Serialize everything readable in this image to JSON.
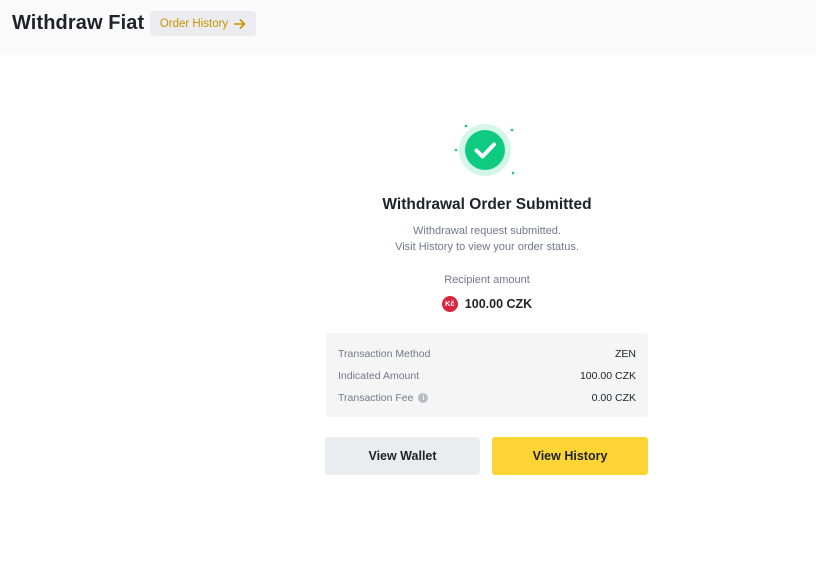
{
  "header": {
    "title": "Withdraw Fiat",
    "order_history_label": "Order History"
  },
  "result": {
    "title": "Withdrawal Order Submitted",
    "desc_line1": "Withdrawal request submitted.",
    "desc_line2": "Visit History to view your order status.",
    "recipient_label": "Recipient amount",
    "recipient_currency_icon_text": "Kč",
    "recipient_amount": "100.00 CZK"
  },
  "details": {
    "rows": [
      {
        "key": "Transaction Method",
        "value": "ZEN"
      },
      {
        "key": "Indicated Amount",
        "value": "100.00 CZK"
      },
      {
        "key": "Transaction Fee",
        "value": "0.00 CZK",
        "info_icon": "i"
      }
    ]
  },
  "actions": {
    "view_wallet": "View Wallet",
    "view_history": "View History"
  },
  "colors": {
    "accent_yellow": "#fcd535",
    "link_gold": "#c99400",
    "success_green": "#0ecb81",
    "czk_red": "#d7263d"
  },
  "icons": {
    "success": "check-circle-icon",
    "arrow": "arrow-right-icon",
    "currency": "czk-icon",
    "info": "info-icon"
  }
}
